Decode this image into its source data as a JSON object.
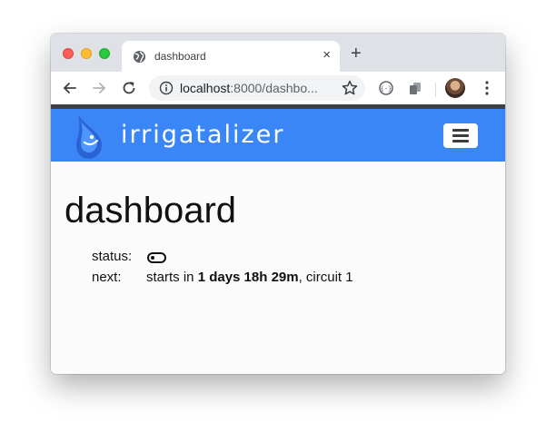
{
  "browser": {
    "tab_title": "dashboard",
    "tab_favicon": "globe-icon",
    "close_glyph": "×",
    "new_tab_glyph": "+",
    "url_host": "localhost",
    "url_rest": ":8000/dashbo..."
  },
  "app": {
    "brand": "irrigatalizer",
    "brand_color": "#3b86f7",
    "logo_icon": "water-drop-icon",
    "menu_icon": "hamburger-icon"
  },
  "page": {
    "title": "dashboard",
    "status_label": "status:",
    "status_toggle_on": false,
    "next_label": "next:",
    "next_prefix": "starts in ",
    "next_duration": "1 days 18h 29m",
    "next_suffix": ", circuit 1"
  }
}
